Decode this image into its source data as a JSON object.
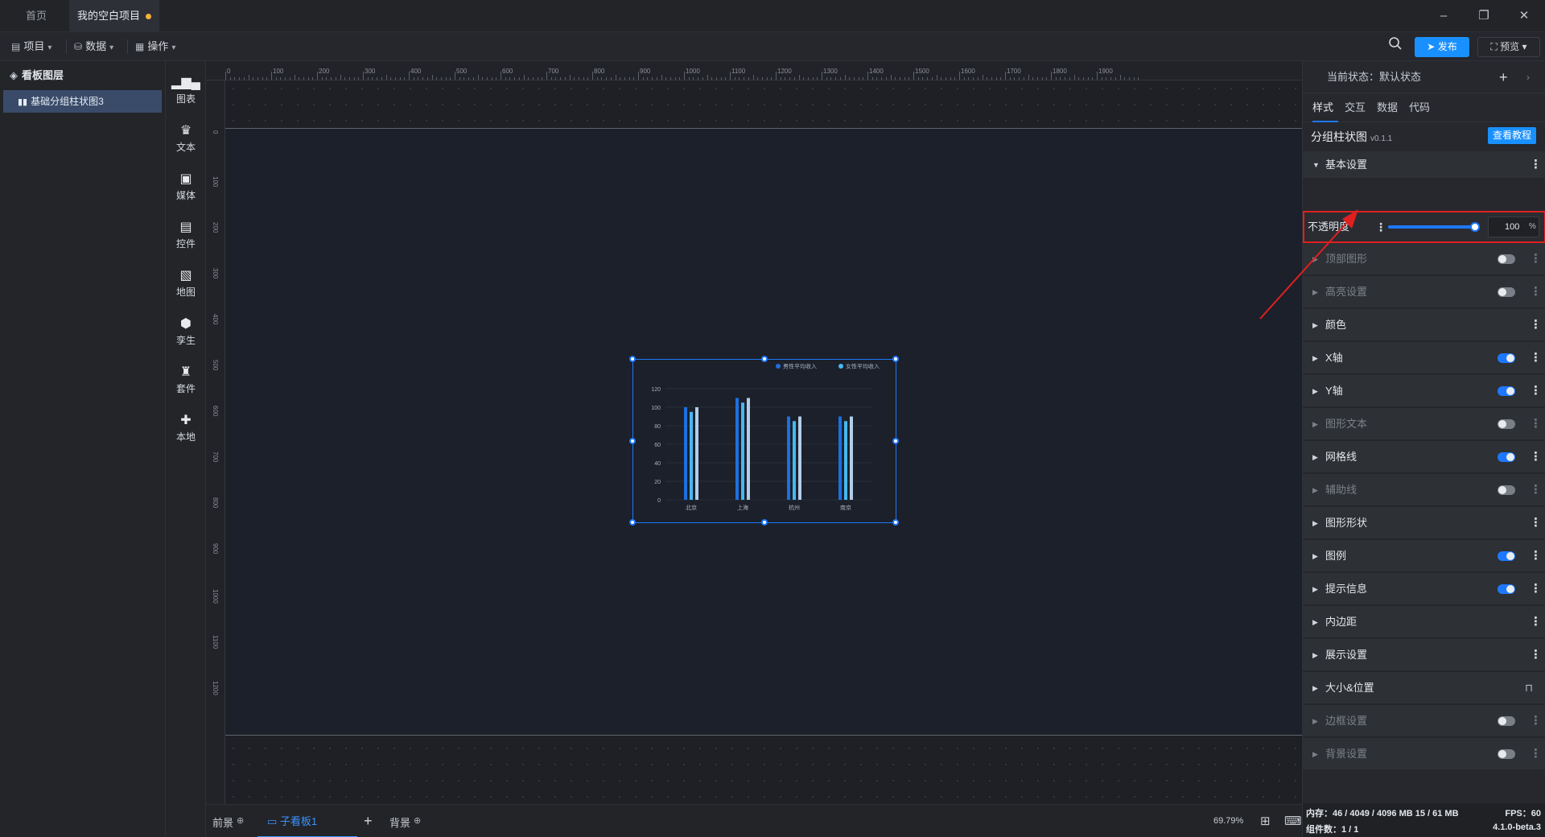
{
  "titlebar": {
    "tabs": [
      {
        "label": "首页"
      },
      {
        "label": "我的空白项目"
      }
    ],
    "window": {
      "minimize": "–",
      "restore": "❐",
      "close": "✕"
    }
  },
  "menubar": {
    "items": [
      {
        "label": "项目"
      },
      {
        "label": "数据"
      },
      {
        "label": "操作"
      }
    ],
    "publish_label": "发布",
    "preview_label": "预览"
  },
  "layers": {
    "title": "看板图层",
    "items": [
      {
        "label": "基础分组柱状图3"
      }
    ]
  },
  "toolbox": {
    "items": [
      {
        "label": "图表",
        "icon": "bar-chart-icon"
      },
      {
        "label": "文本",
        "icon": "text-icon"
      },
      {
        "label": "媒体",
        "icon": "media-icon"
      },
      {
        "label": "控件",
        "icon": "control-icon"
      },
      {
        "label": "地图",
        "icon": "map-icon"
      },
      {
        "label": "孪生",
        "icon": "twin-icon"
      },
      {
        "label": "套件",
        "icon": "kit-icon"
      },
      {
        "label": "本地",
        "icon": "plugin-icon"
      }
    ]
  },
  "canvas": {
    "ruler_top": [
      "0",
      "100",
      "200",
      "300",
      "400",
      "500",
      "600",
      "700",
      "800",
      "900",
      "1000",
      "1100",
      "1200",
      "1300",
      "1400",
      "1500",
      "1600",
      "1700",
      "1800",
      "1900"
    ],
    "ruler_left": [
      "0",
      "100",
      "200",
      "300",
      "400",
      "500",
      "600",
      "700",
      "800",
      "900",
      "1000",
      "1100",
      "1200"
    ]
  },
  "chart_data": {
    "type": "bar",
    "categories": [
      "北京",
      "上海",
      "杭州",
      "南京"
    ],
    "series": [
      {
        "name": "男性平均收入",
        "values": [
          100,
          110,
          90,
          90
        ],
        "color": "#1e6fe0"
      },
      {
        "name": "女性平均收入",
        "values": [
          95,
          105,
          85,
          85
        ],
        "color": "#47b8f0"
      },
      {
        "name": "",
        "values": [
          100,
          110,
          90,
          90
        ],
        "color": "#b3cde8"
      }
    ],
    "y_ticks": [
      "0",
      "20",
      "40",
      "60",
      "80",
      "100",
      "120"
    ],
    "ylim": [
      0,
      120
    ],
    "legend_position": "top-right",
    "grid": true
  },
  "bottombar": {
    "tabs": [
      {
        "label": "前景"
      },
      {
        "label": "子看板1"
      },
      {
        "label": "背景"
      }
    ],
    "zoom": "69.79%"
  },
  "rpanel": {
    "state_label": "当前状态：默认状态",
    "tabs": [
      {
        "label": "样式"
      },
      {
        "label": "交互"
      },
      {
        "label": "数据"
      },
      {
        "label": "代码"
      }
    ],
    "component_title": "分组柱状图",
    "version": "v0.1.1",
    "tutorial_label": "查看教程",
    "basic_settings": "基本设置",
    "opacity": {
      "label": "不透明度",
      "value": "100",
      "unit": "%",
      "level": 100
    },
    "sections": [
      {
        "label": "顶部图形",
        "toggle": "off",
        "dim": true
      },
      {
        "label": "高亮设置",
        "toggle": "off",
        "dim": true
      },
      {
        "label": "颜色",
        "toggle": "none",
        "dim": false
      },
      {
        "label": "X轴",
        "toggle": "on",
        "dim": false
      },
      {
        "label": "Y轴",
        "toggle": "on",
        "dim": false
      },
      {
        "label": "图形文本",
        "toggle": "off",
        "dim": true
      },
      {
        "label": "网格线",
        "toggle": "on",
        "dim": false
      },
      {
        "label": "辅助线",
        "toggle": "off",
        "dim": true
      },
      {
        "label": "图形形状",
        "toggle": "none",
        "dim": false
      },
      {
        "label": "图例",
        "toggle": "on",
        "dim": false
      },
      {
        "label": "提示信息",
        "toggle": "on",
        "dim": false
      },
      {
        "label": "内边距",
        "toggle": "none",
        "dim": false
      },
      {
        "label": "展示设置",
        "toggle": "none",
        "dim": false
      },
      {
        "label": "大小&位置",
        "toggle": "lock",
        "dim": false
      },
      {
        "label": "边框设置",
        "toggle": "off",
        "dim": true
      },
      {
        "label": "背景设置",
        "toggle": "off",
        "dim": true
      }
    ],
    "status": {
      "memory": "内存：46 / 4049 / 4096 MB  15 / 61 MB",
      "fps": "FPS：60",
      "components": "组件数：1 / 1",
      "version": "4.1.0-beta.3"
    }
  }
}
